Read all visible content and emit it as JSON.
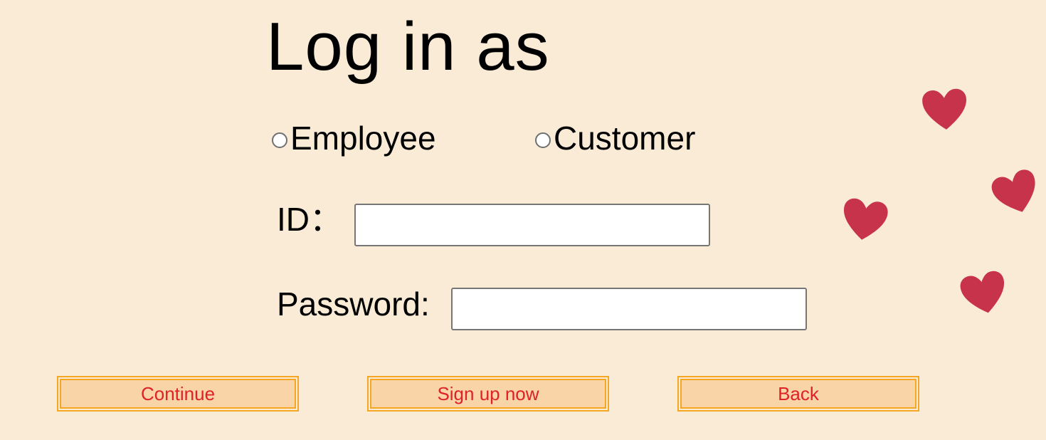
{
  "title": "Log in as",
  "roles": [
    {
      "label": "Employee",
      "selected": false
    },
    {
      "label": "Customer",
      "selected": false
    }
  ],
  "form": {
    "id_label": "ID：",
    "id_value": "",
    "password_label": "Password:",
    "password_value": ""
  },
  "buttons": {
    "continue": "Continue",
    "signup": "Sign up now",
    "back": "Back"
  },
  "decorations": {
    "icon": "heart-icon",
    "count": 4,
    "color": "#c6334a"
  },
  "colors": {
    "background": "#faebd7",
    "button_bg": "#f8d4a6",
    "button_border": "#f5a623",
    "button_text": "#e0202a"
  }
}
